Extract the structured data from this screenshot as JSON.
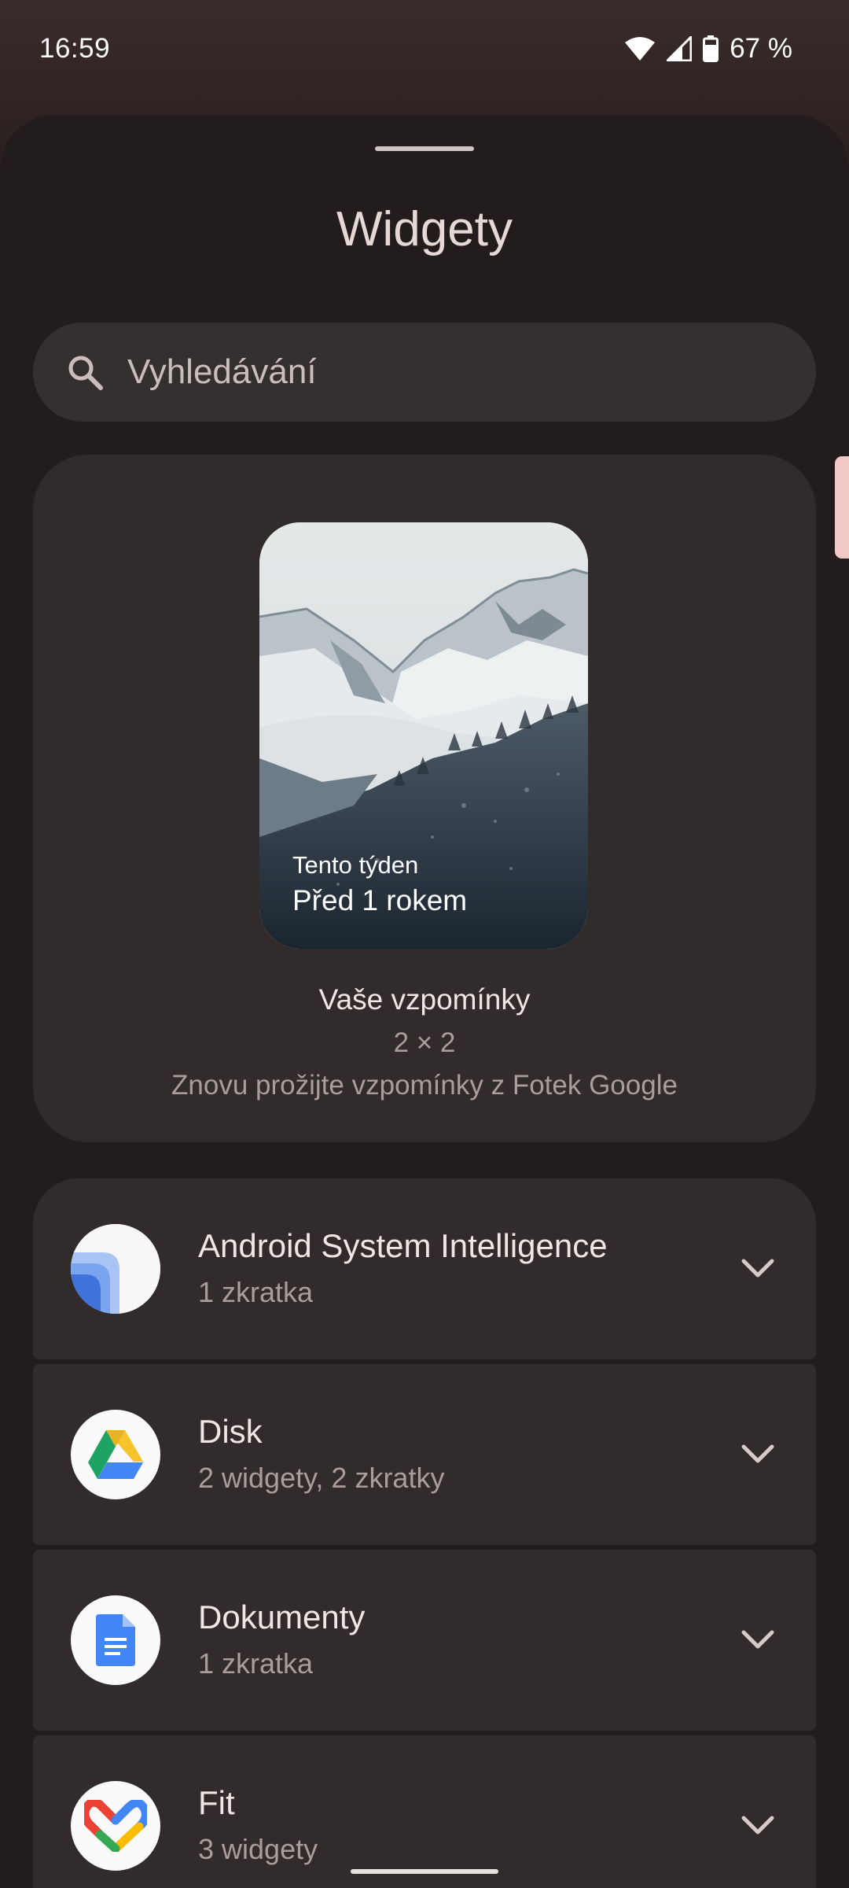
{
  "status_bar": {
    "time": "16:59",
    "battery_text": "67 %",
    "icons": [
      "wifi-icon",
      "signal-icon",
      "battery-icon"
    ]
  },
  "sheet": {
    "title": "Widgety"
  },
  "search": {
    "placeholder": "Vyhledávání"
  },
  "featured_widget": {
    "preview_line1": "Tento týden",
    "preview_line2": "Před 1 rokem",
    "name": "Vaše vzpomínky",
    "size": "2 × 2",
    "description": "Znovu prožijte vzpomínky z Fotek Google"
  },
  "apps": [
    {
      "title": "Android System Intelligence",
      "subtitle": "1 zkratka",
      "icon": "android-system-intelligence-icon"
    },
    {
      "title": "Disk",
      "subtitle": "2 widgety, 2 zkratky",
      "icon": "google-drive-icon"
    },
    {
      "title": "Dokumenty",
      "subtitle": "1 zkratka",
      "icon": "google-docs-icon"
    },
    {
      "title": "Fit",
      "subtitle": "3 widgety",
      "icon": "google-fit-icon"
    }
  ],
  "colors": {
    "sheet_bg": "#221c1c",
    "card_bg": "#312b2b",
    "search_bg": "#353030",
    "accent_scrollbar": "#f2c9c6"
  }
}
